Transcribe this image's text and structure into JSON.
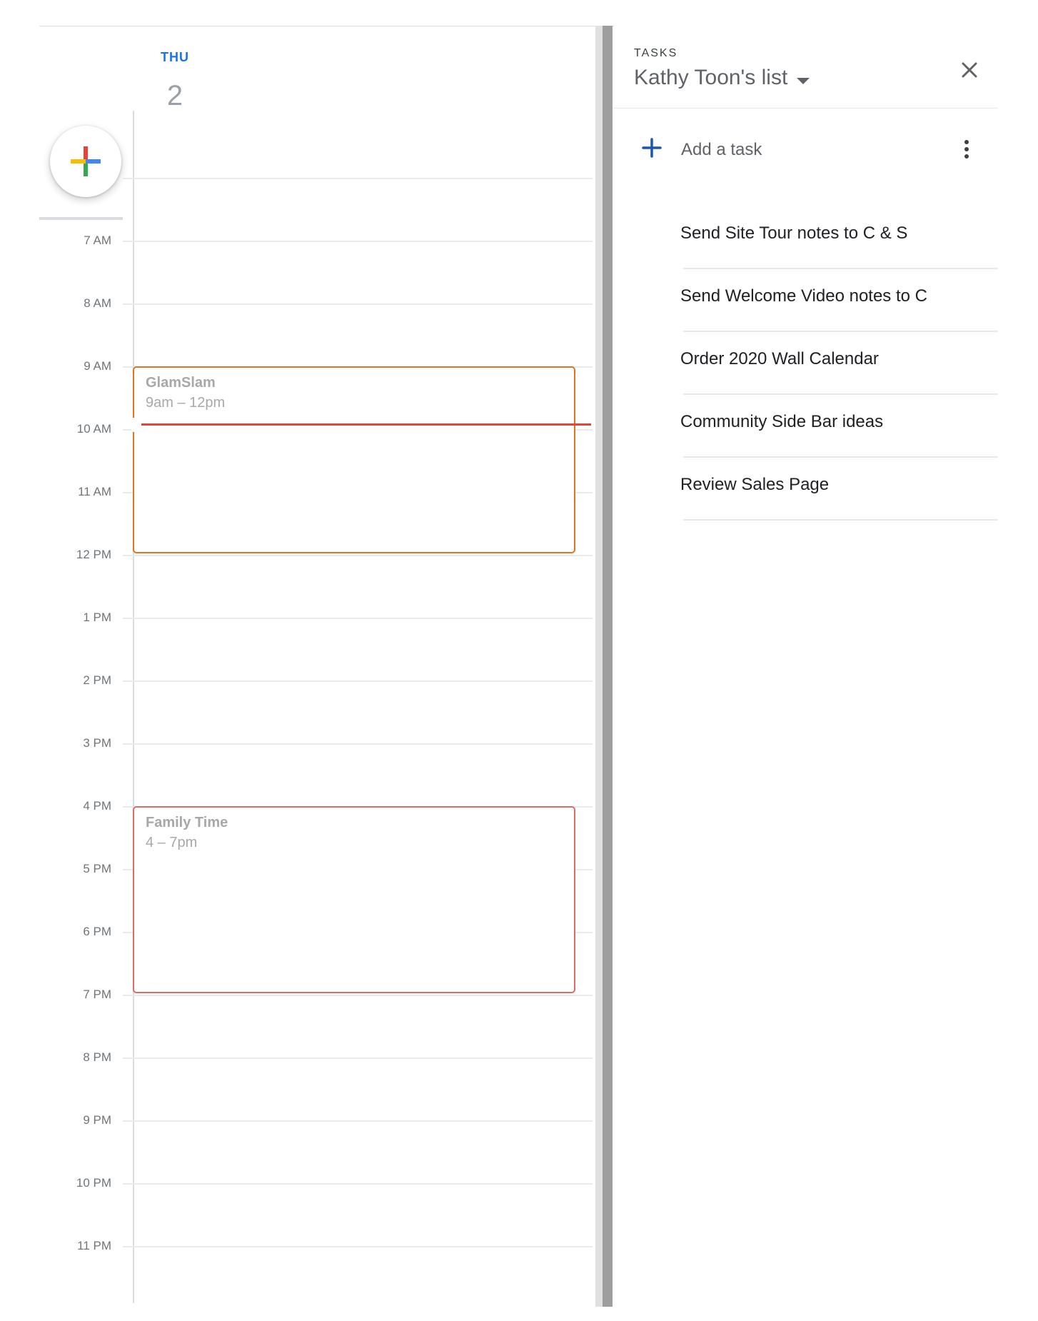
{
  "day_header": {
    "weekday": "THU",
    "date": "2"
  },
  "hours": [
    "7 AM",
    "8 AM",
    "9 AM",
    "10 AM",
    "11 AM",
    "12 PM",
    "1 PM",
    "2 PM",
    "3 PM",
    "4 PM",
    "5 PM",
    "6 PM",
    "7 PM",
    "8 PM",
    "9 PM",
    "10 PM",
    "11 PM"
  ],
  "events": [
    {
      "title": "GlamSlam",
      "time": "9am – 12pm",
      "color": "#e8711c"
    },
    {
      "title": "Family Time",
      "time": "4 – 7pm",
      "color": "#e06b64"
    }
  ],
  "create_button": {
    "icon": "google-plus-icon"
  },
  "tasks_panel": {
    "section_label": "TASKS",
    "list_name": "Kathy Toon's list",
    "add_label": "Add a task",
    "items": [
      {
        "label": "Send Site Tour notes to C & S"
      },
      {
        "label": "Send Welcome Video notes to C"
      },
      {
        "label": "Order 2020 Wall Calendar"
      },
      {
        "label": "Community Side Bar ideas"
      },
      {
        "label": "Review Sales Page"
      }
    ]
  },
  "colors": {
    "accent": "#1a73e8",
    "now_indicator": "#ea4335"
  }
}
